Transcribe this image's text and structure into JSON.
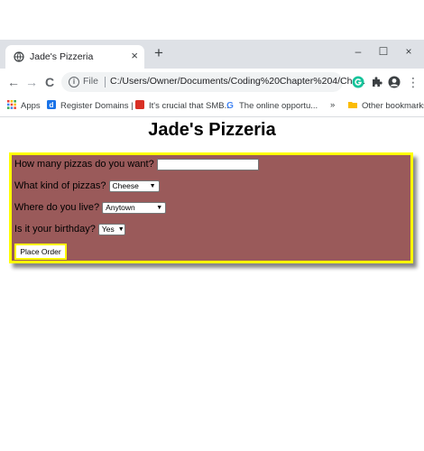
{
  "browser": {
    "tab": {
      "title": "Jade's Pizzeria",
      "close_glyph": "×"
    },
    "new_tab_glyph": "+",
    "window_controls": {
      "minimize": "–",
      "maximize": "☐",
      "close": "×"
    },
    "toolbar": {
      "back_glyph": "←",
      "forward_glyph": "→",
      "reload_glyph": "C",
      "info_glyph": "i",
      "scheme": "File",
      "url": "C:/Users/Owner/Documents/Coding%20Chapter%204/Cha...",
      "star_glyph": "☆",
      "menu_glyph": "⋮"
    },
    "bookmarks": {
      "apps": "Apps",
      "items": [
        "Register Domains | ...",
        "It's crucial that SMB...",
        "The online opportu..."
      ],
      "overflow": "»",
      "other": "Other bookmarks"
    }
  },
  "page": {
    "title": "Jade's Pizzeria",
    "form": {
      "quantity_label": "How many pizzas do you want?",
      "quantity_value": "",
      "kind_label": "What kind of pizzas?",
      "kind_value": "Cheese",
      "location_label": "Where do you live?",
      "location_value": "Anytown",
      "birthday_label": "Is it your birthday?",
      "birthday_value": "Yes",
      "submit_label": "Place Order"
    }
  },
  "colors": {
    "form_background": "#9a5a5a",
    "form_border": "#ffff00",
    "tabstrip": "#dee1e6"
  }
}
